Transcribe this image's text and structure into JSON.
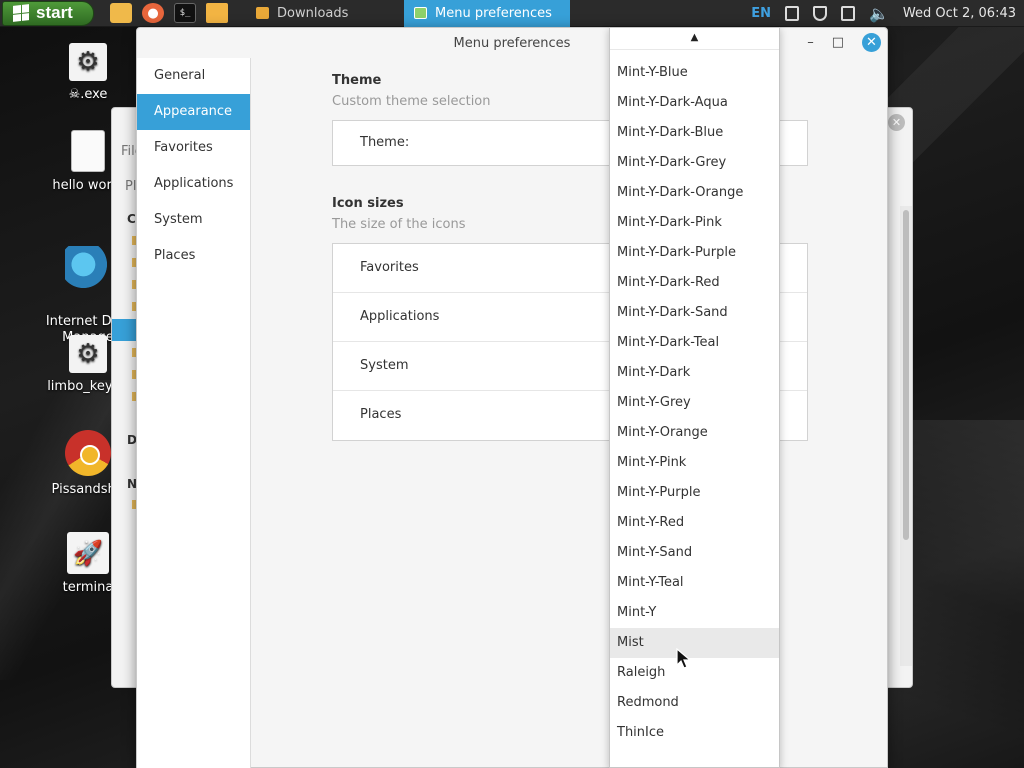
{
  "taskbar": {
    "start_label": "start",
    "tasks": [
      {
        "label": "Downloads",
        "active": false
      },
      {
        "label": "Menu preferences",
        "active": true
      }
    ],
    "tray": {
      "language": "EN",
      "clock": "Wed Oct  2, 06:43"
    }
  },
  "desktop_icons": [
    {
      "label": "☠.exe",
      "icon": "gear-icon"
    },
    {
      "label": "hello world",
      "icon": "document-icon"
    },
    {
      "label": "Internet Dow\nManage",
      "icon": "idm-icon"
    },
    {
      "label": "limbo_keyge",
      "icon": "gear-icon"
    },
    {
      "label": "Pissandshit",
      "icon": "chrome-icon"
    },
    {
      "label": "termina",
      "icon": "rocket-icon"
    }
  ],
  "background_window": {
    "file_text": "File",
    "pl_text": "Pl",
    "co_text": "Co",
    "d_text": "D",
    "n_text": "N"
  },
  "window": {
    "title": "Menu preferences",
    "controls": {
      "minimize": "–",
      "maximize": "□",
      "close": "✕"
    }
  },
  "sidebar": {
    "items": [
      {
        "label": "General",
        "active": false
      },
      {
        "label": "Appearance",
        "active": true
      },
      {
        "label": "Favorites",
        "active": false
      },
      {
        "label": "Applications",
        "active": false
      },
      {
        "label": "System",
        "active": false
      },
      {
        "label": "Places",
        "active": false
      }
    ]
  },
  "theme_section": {
    "title": "Theme",
    "subtitle": "Custom theme selection",
    "row_label": "Theme:"
  },
  "icon_sizes_section": {
    "title": "Icon sizes",
    "subtitle": "The size of the icons",
    "rows": [
      "Favorites",
      "Applications",
      "System",
      "Places"
    ]
  },
  "theme_dropdown": {
    "scroll_up_arrow": "▲",
    "options": [
      "Mint-Y-Blue",
      "Mint-Y-Dark-Aqua",
      "Mint-Y-Dark-Blue",
      "Mint-Y-Dark-Grey",
      "Mint-Y-Dark-Orange",
      "Mint-Y-Dark-Pink",
      "Mint-Y-Dark-Purple",
      "Mint-Y-Dark-Red",
      "Mint-Y-Dark-Sand",
      "Mint-Y-Dark-Teal",
      "Mint-Y-Dark",
      "Mint-Y-Grey",
      "Mint-Y-Orange",
      "Mint-Y-Pink",
      "Mint-Y-Purple",
      "Mint-Y-Red",
      "Mint-Y-Sand",
      "Mint-Y-Teal",
      "Mint-Y",
      "Mist",
      "Raleigh",
      "Redmond",
      "ThinIce"
    ],
    "hovered": "Mist"
  },
  "colors": {
    "accent": "#37a0d8",
    "start_green": "#3f8a2e",
    "taskbar_bg": "#2b2b2b"
  }
}
